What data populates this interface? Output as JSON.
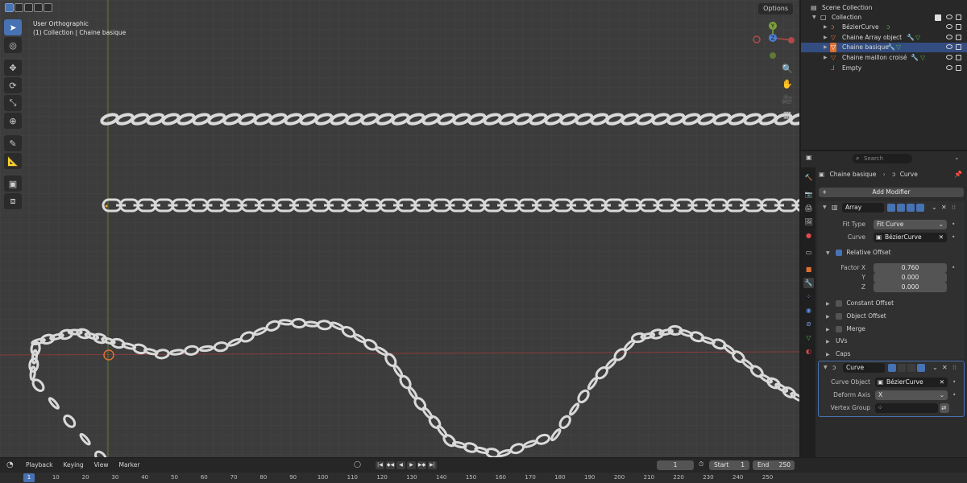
{
  "viewport": {
    "view_name": "User Orthographic",
    "context": "(1) Collection | Chaine basique",
    "options_label": "Options"
  },
  "gizmo": {
    "y": "Y",
    "z": "Z"
  },
  "outliner": {
    "title": "Scene Collection",
    "collection": "Collection",
    "items": [
      "BézierCurve",
      "Chaine Array object",
      "Chaine basique",
      "Chaine maillon croisé",
      "Empty"
    ]
  },
  "properties": {
    "search_placeholder": "Search",
    "breadcrumb_object": "Chaine basique",
    "breadcrumb_data": "Curve",
    "add_modifier": "Add Modifier",
    "array": {
      "name": "Array",
      "fit_type_label": "Fit Type",
      "fit_type": "Fit Curve",
      "curve_label": "Curve",
      "curve": "BézierCurve",
      "relative_offset": "Relative Offset",
      "factor_x_label": "Factor X",
      "factor_x": "0.760",
      "y_label": "Y",
      "y": "0.000",
      "z_label": "Z",
      "z": "0.000",
      "constant_offset": "Constant Offset",
      "object_offset": "Object Offset",
      "merge": "Merge",
      "uvs": "UVs",
      "caps": "Caps"
    },
    "curve_mod": {
      "name": "Curve",
      "curve_object_label": "Curve Object",
      "curve_object": "BézierCurve",
      "deform_axis_label": "Deform Axis",
      "deform_axis": "X",
      "vertex_group_label": "Vertex Group"
    }
  },
  "timeline": {
    "menus": [
      "Playback",
      "Keying",
      "View",
      "Marker"
    ],
    "current_frame": "1",
    "start_label": "Start",
    "start": "1",
    "end_label": "End",
    "end": "250",
    "ticks": [
      "1",
      "10",
      "20",
      "30",
      "40",
      "50",
      "60",
      "70",
      "80",
      "90",
      "100",
      "110",
      "120",
      "130",
      "140",
      "150",
      "160",
      "170",
      "180",
      "190",
      "200",
      "210",
      "220",
      "230",
      "240",
      "250"
    ]
  },
  "colors": {
    "accent": "#4772b3",
    "x_axis": "#b04a4a",
    "y_axis": "#7fa03a"
  }
}
